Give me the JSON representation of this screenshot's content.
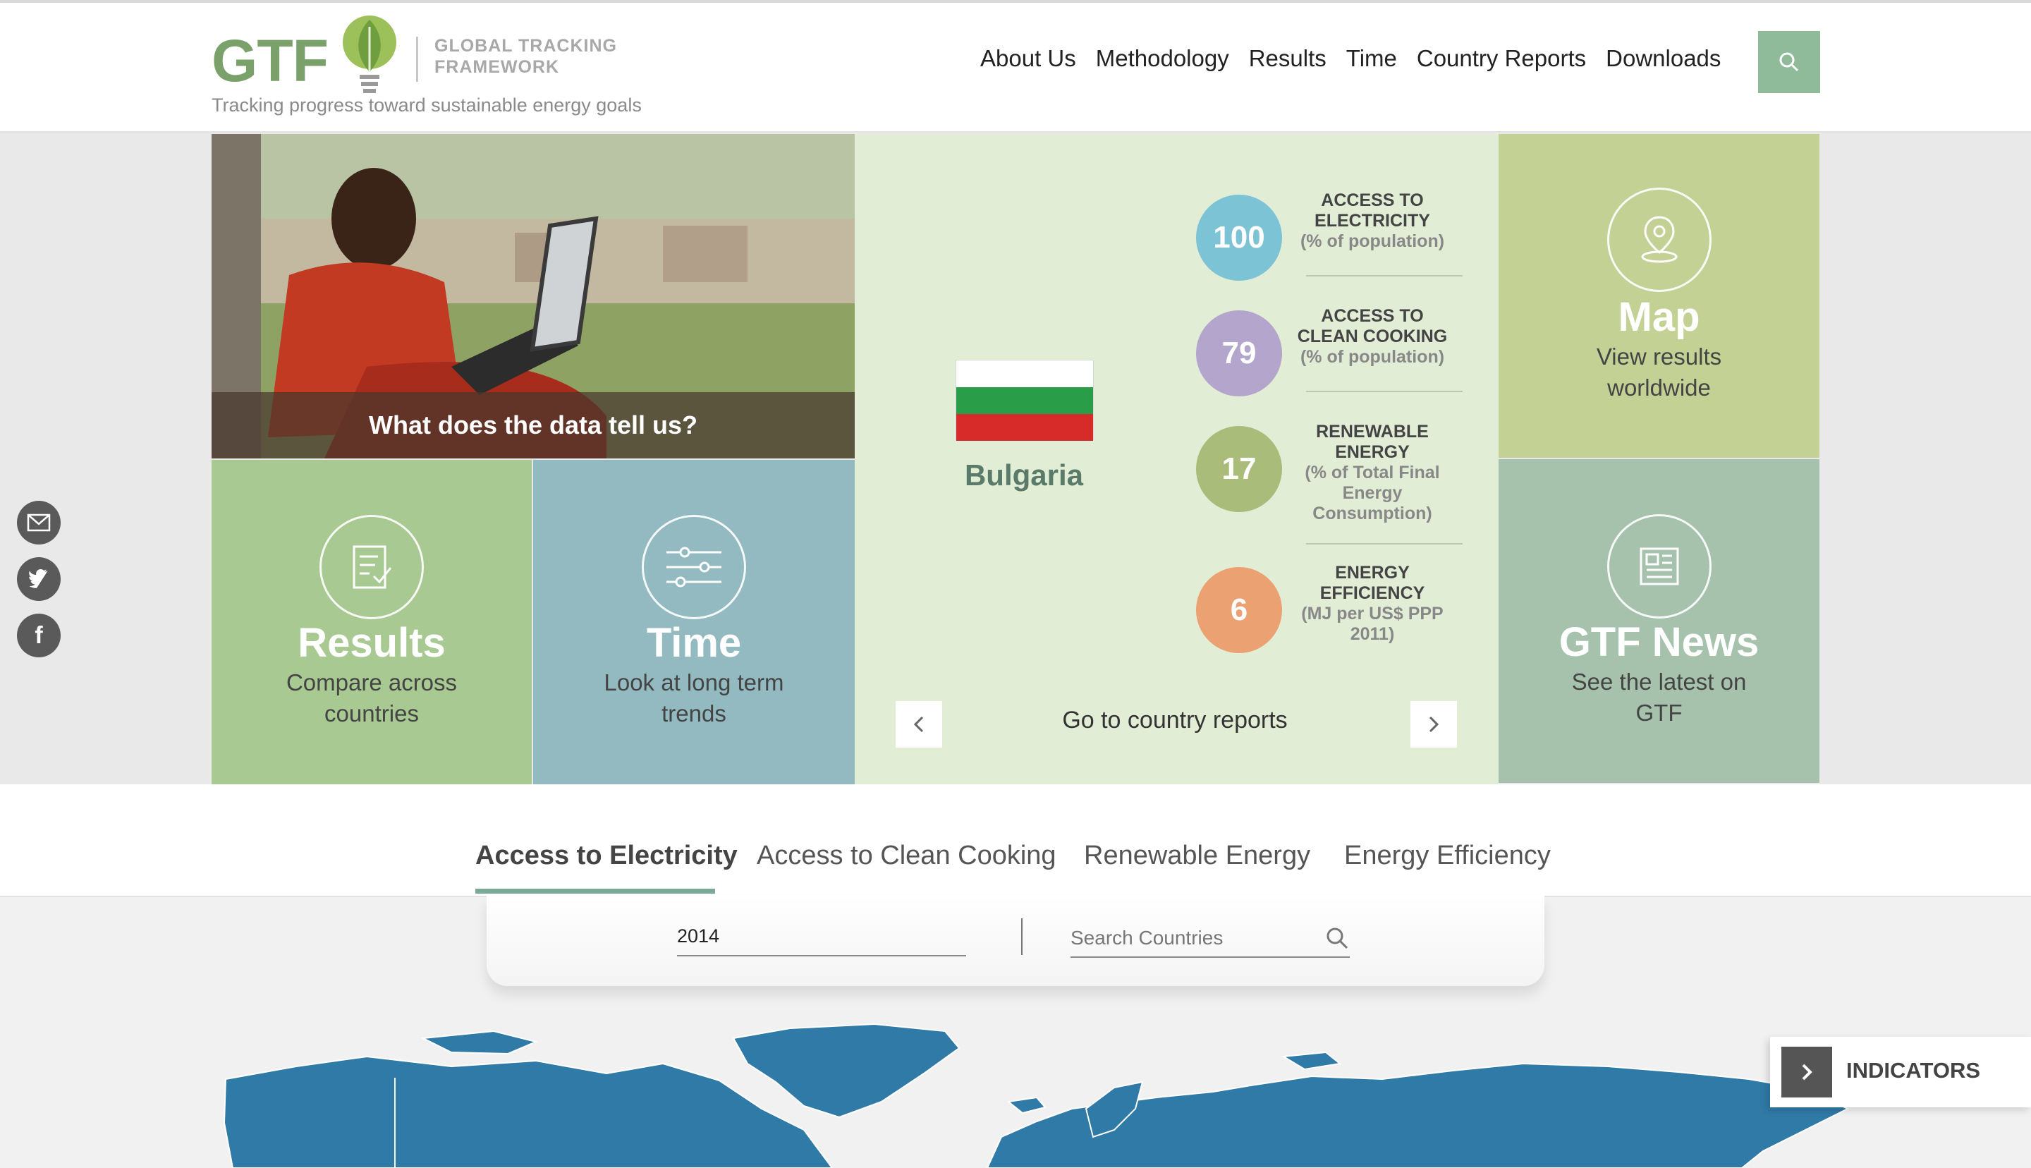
{
  "header": {
    "logo_text": "GTF",
    "logo_subtitle_line1": "GLOBAL TRACKING",
    "logo_subtitle_line2": "FRAMEWORK",
    "tagline": "Tracking progress toward sustainable energy goals",
    "nav": [
      "About Us",
      "Methodology",
      "Results",
      "Time",
      "Country Reports",
      "Downloads"
    ]
  },
  "hero": {
    "photo_caption": "What does the data tell us?",
    "results": {
      "title": "Results",
      "subtitle": "Compare across countries"
    },
    "time": {
      "title": "Time",
      "subtitle": "Look at long term trends"
    },
    "map": {
      "title": "Map",
      "subtitle": "View results worldwide"
    },
    "news": {
      "title": "GTF News",
      "subtitle": "See the latest on GTF"
    }
  },
  "country": {
    "name": "Bulgaria",
    "flag_colors": [
      "#ffffff",
      "#2a9d48",
      "#d62b28"
    ],
    "stats": [
      {
        "value": "100",
        "label": "ACCESS TO ELECTRICITY",
        "unit": "(% of population)",
        "color": "#7cc3d5"
      },
      {
        "value": "79",
        "label": "ACCESS TO CLEAN COOKING",
        "unit": "(% of population)",
        "color": "#b3a5cb"
      },
      {
        "value": "17",
        "label": "RENEWABLE ENERGY",
        "unit": "(% of Total Final Energy Consumption)",
        "color": "#a9bc7a"
      },
      {
        "value": "6",
        "label": "ENERGY EFFICIENCY",
        "unit": "(MJ per US$ PPP 2011)",
        "color": "#eba171"
      }
    ],
    "goto_label": "Go to country reports"
  },
  "tabs": [
    "Access to Electricity",
    "Access to Clean Cooking",
    "Renewable Energy",
    "Energy Efficiency"
  ],
  "active_tab": "Access to Electricity",
  "controls": {
    "year": "2014",
    "search_placeholder": "Search Countries"
  },
  "indicators_label": "INDICATORS",
  "colors": {
    "brand_green": "#7aa16a",
    "map_blue": "#2f7aa6",
    "accent": "#8fbb9a"
  }
}
